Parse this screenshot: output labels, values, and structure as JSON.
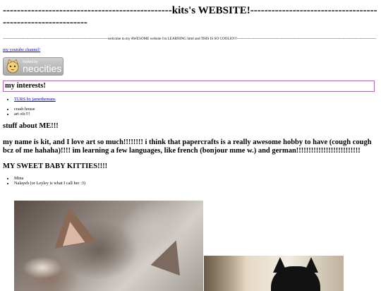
{
  "page": {
    "title": "------------------------------------------------kits's WEBSITE!------------------------------------------------------------",
    "welcome": "--------------------------------------------------------------------------------------welcome to my AWESOME website i'm LEARNING html and THIS IS SO COOLIO!!!------------------------------------------------------------------------------------------------------------------",
    "youtube_link": "my youtube channel!",
    "badge": {
      "small_text": "hosted by",
      "big_text": "neocities"
    },
    "interests": {
      "heading": "my interests!",
      "links": [
        "TURS by jamethemans"
      ],
      "items": [
        "crash house",
        "art ofc!!!"
      ]
    },
    "about": {
      "heading": "stuff about ME!!!",
      "text": "my name is kit, and I love art so much!!!!!!!! i think that papercrafts is a really awesome hobby to have (cough cough bcz of me hahaha)!!!! im learning a few languages, like french (bonjour mme w.) and german!!!!!!!!!!!!!!!!!!!!!!!!!!"
    },
    "kitties": {
      "heading": "MY SWEET BABY KITTIES!!!!",
      "items": [
        "Mina",
        "Nalayeh (or Leyley is what I call her :3)"
      ]
    }
  }
}
